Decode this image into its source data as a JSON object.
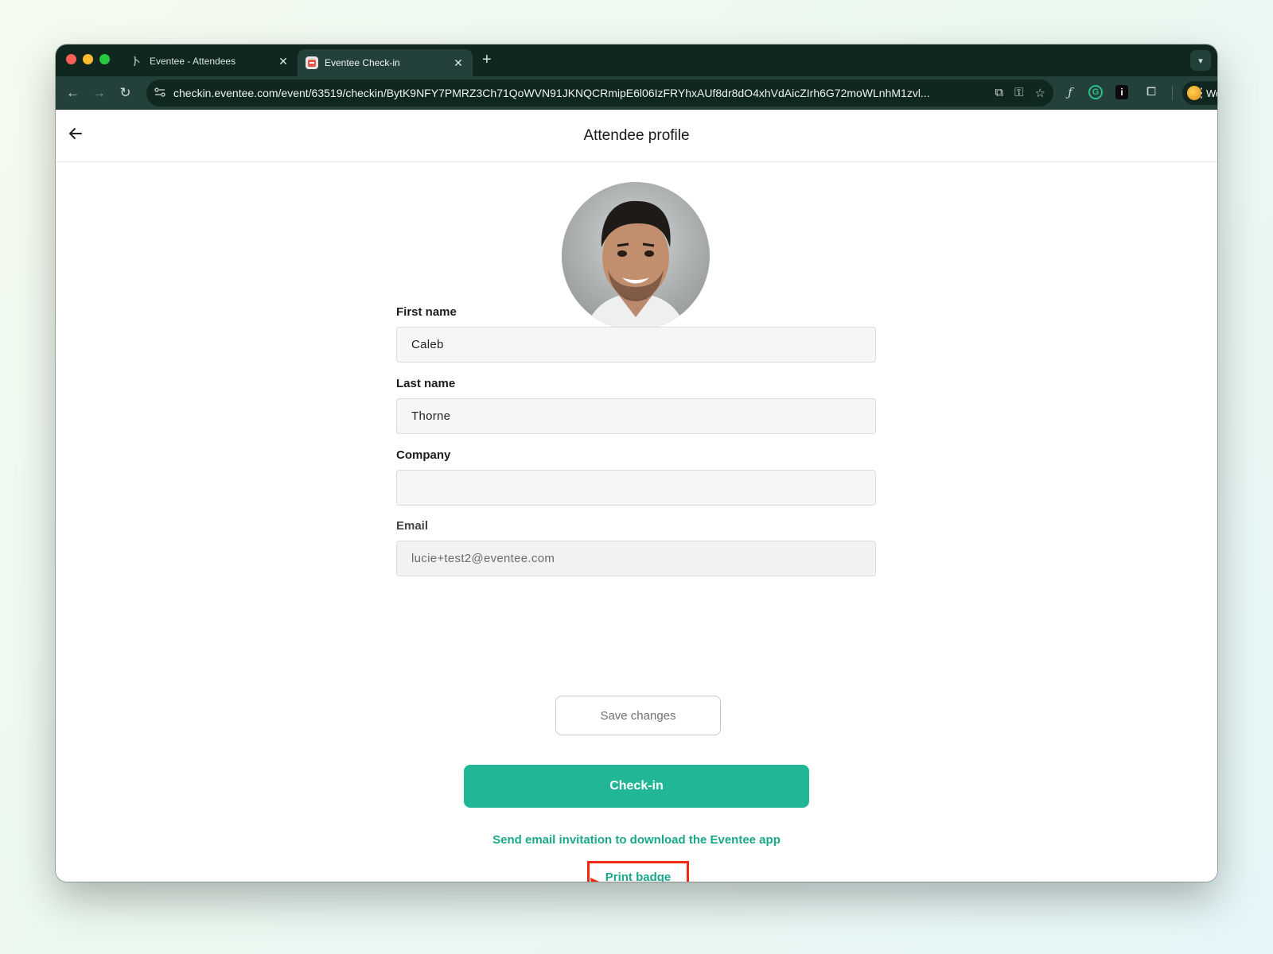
{
  "browser": {
    "tabs": [
      {
        "title": "Eventee - Attendees",
        "favicon": "eventee-leaf-icon",
        "active": false
      },
      {
        "title": "Eventee Check-in",
        "favicon": "eventee-app-icon",
        "active": true
      }
    ],
    "new_tab_label": "+",
    "url": "checkin.eventee.com/event/63519/checkin/BytK9NFY7PMRZ3Ch71QoWVN91JKNQCRmipE6l06IzFRYhxAUf8dr8dO4xhVdAicZIrh6G72moWLnhM1zvl...",
    "profile_label": "Work",
    "colors": {
      "tabbar": "#10271f",
      "toolbar": "#23413a"
    }
  },
  "app": {
    "title": "Attendee profile",
    "fields": {
      "first_name": {
        "label": "First name",
        "value": "Caleb"
      },
      "last_name": {
        "label": "Last name",
        "value": "Thorne"
      },
      "company": {
        "label": "Company",
        "value": ""
      },
      "email": {
        "label": "Email",
        "value": "lucie+test2@eventee.com"
      }
    },
    "save_label": "Save changes",
    "checkin_label": "Check-in",
    "invite_link": "Send email invitation to download the Eventee app",
    "print_badge_label": "Print badge",
    "colors": {
      "accent": "#21b796",
      "link": "#1aa889",
      "highlight": "#ef2b14"
    }
  }
}
